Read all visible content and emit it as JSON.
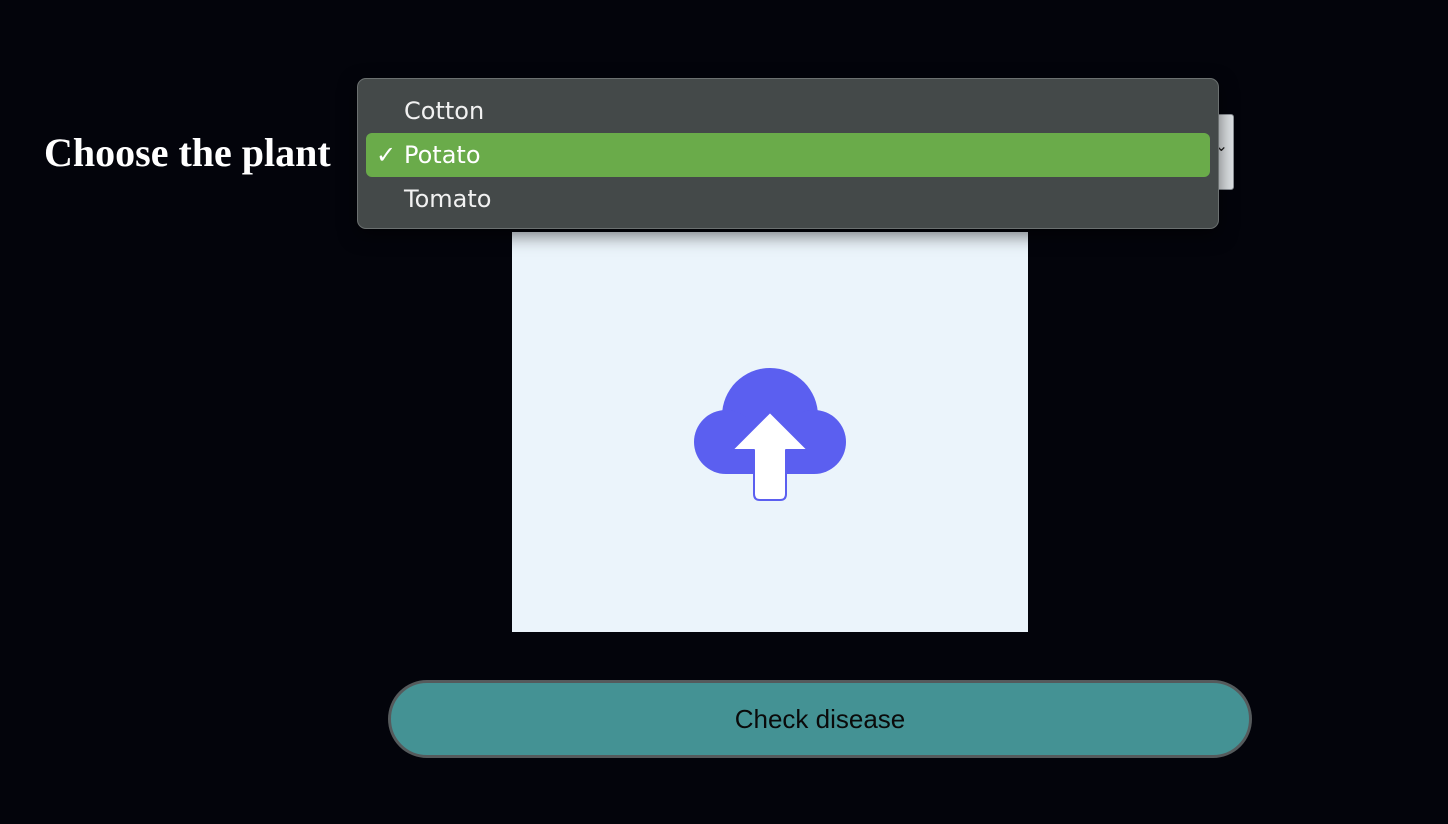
{
  "form": {
    "plant_label": "Choose the plant",
    "plant_select": {
      "selected": "Potato",
      "options": [
        {
          "label": "Cotton",
          "selected": false
        },
        {
          "label": "Potato",
          "selected": true
        },
        {
          "label": "Tomato",
          "selected": false
        }
      ],
      "checkmark": "✓"
    },
    "upload": {
      "icon": "cloud-upload-icon",
      "icon_color": "#5b5ff0",
      "background_color": "#ebf4fb"
    },
    "submit_label": "Check disease"
  },
  "colors": {
    "page_background": "#03040b",
    "selected_option": "#6aab4a",
    "menu_background": "#444949",
    "button_background": "#449294"
  }
}
